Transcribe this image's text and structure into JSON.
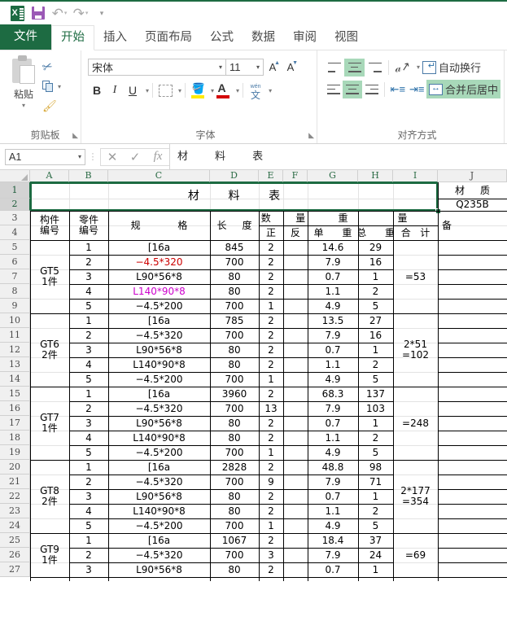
{
  "quick_access": {
    "app_icon": "excel-logo-icon",
    "items": [
      {
        "name": "save-icon",
        "label": ""
      },
      {
        "name": "undo-icon",
        "label": ""
      },
      {
        "name": "redo-icon",
        "label": ""
      },
      {
        "name": "customize-qat-icon",
        "label": ""
      }
    ]
  },
  "ribbon_tabs": [
    {
      "label": "文件",
      "active": false,
      "file": true
    },
    {
      "label": "开始",
      "active": true
    },
    {
      "label": "插入",
      "active": false
    },
    {
      "label": "页面布局",
      "active": false
    },
    {
      "label": "公式",
      "active": false
    },
    {
      "label": "数据",
      "active": false
    },
    {
      "label": "审阅",
      "active": false
    },
    {
      "label": "视图",
      "active": false
    }
  ],
  "ribbon": {
    "clipboard": {
      "group_label": "剪贴板",
      "paste_label": "粘贴",
      "cut_name": "cut-icon",
      "copy_name": "copy-icon",
      "format_painter_name": "format-painter-icon"
    },
    "font": {
      "group_label": "字体",
      "font_name": "宋体",
      "font_size": "11",
      "grow_font": "A",
      "shrink_font": "A",
      "bold": "B",
      "italic": "I",
      "underline": "U",
      "phonetic_top": "wén",
      "phonetic_bottom": "文"
    },
    "alignment": {
      "group_label": "对齐方式",
      "wrap_text": "自动换行",
      "merge_center": "合并后居中"
    }
  },
  "formula_bar": {
    "name_box": "A1",
    "cancel": "✕",
    "enter": "✓",
    "fx": "fx",
    "content": "材        料        表"
  },
  "sheet": {
    "columns": [
      "A",
      "B",
      "C",
      "D",
      "E",
      "F",
      "G",
      "H",
      "I",
      "J"
    ],
    "row_numbers": [
      1,
      2,
      3,
      4,
      5,
      6,
      7,
      8,
      9,
      10,
      11,
      12,
      13,
      14,
      15,
      16,
      17,
      18,
      19,
      20,
      21,
      22,
      23,
      24,
      25,
      26,
      27
    ],
    "selection": "A1:I2",
    "title": "材        料        表",
    "side_label_material": "材     质",
    "side_label_grade": "Q235B",
    "side_label_remark": "备",
    "headers": {
      "component_no": "构件\n编号",
      "part_no": "零件\n编号",
      "spec": "规            格",
      "length": "长     度",
      "qty_group": "数        量",
      "qty_front": "正",
      "qty_back": "反",
      "weight_group": "重                量",
      "unit_weight": "单      重",
      "total_weight": "总      重",
      "sum_weight": "合   计"
    },
    "blocks": [
      {
        "component": "GT5\n1件",
        "sum": "=53",
        "rows": [
          {
            "no": "1",
            "spec": "[16a",
            "len": "845",
            "front": "2",
            "back": "",
            "unit": "14.6",
            "total": "29",
            "color": "#000000"
          },
          {
            "no": "2",
            "spec": "−4.5*320",
            "len": "700",
            "front": "2",
            "back": "",
            "unit": "7.9",
            "total": "16",
            "color": "#cc0000"
          },
          {
            "no": "3",
            "spec": "L90*56*8",
            "len": "80",
            "front": "2",
            "back": "",
            "unit": "0.7",
            "total": "1",
            "color": "#000000"
          },
          {
            "no": "4",
            "spec": "L140*90*8",
            "len": "80",
            "front": "2",
            "back": "",
            "unit": "1.1",
            "total": "2",
            "color": "#cc00cc"
          },
          {
            "no": "5",
            "spec": "−4.5*200",
            "len": "700",
            "front": "1",
            "back": "",
            "unit": "4.9",
            "total": "5",
            "color": "#000000"
          }
        ]
      },
      {
        "component": "GT6\n2件",
        "sum": "2*51\n=102",
        "rows": [
          {
            "no": "1",
            "spec": "[16a",
            "len": "785",
            "front": "2",
            "back": "",
            "unit": "13.5",
            "total": "27",
            "color": "#000000"
          },
          {
            "no": "2",
            "spec": "−4.5*320",
            "len": "700",
            "front": "2",
            "back": "",
            "unit": "7.9",
            "total": "16",
            "color": "#000000"
          },
          {
            "no": "3",
            "spec": "L90*56*8",
            "len": "80",
            "front": "2",
            "back": "",
            "unit": "0.7",
            "total": "1",
            "color": "#000000"
          },
          {
            "no": "4",
            "spec": "L140*90*8",
            "len": "80",
            "front": "2",
            "back": "",
            "unit": "1.1",
            "total": "2",
            "color": "#000000"
          },
          {
            "no": "5",
            "spec": "−4.5*200",
            "len": "700",
            "front": "1",
            "back": "",
            "unit": "4.9",
            "total": "5",
            "color": "#000000"
          }
        ]
      },
      {
        "component": "GT7\n1件",
        "sum": "=248",
        "rows": [
          {
            "no": "1",
            "spec": "[16a",
            "len": "3960",
            "front": "2",
            "back": "",
            "unit": "68.3",
            "total": "137",
            "color": "#000000"
          },
          {
            "no": "2",
            "spec": "−4.5*320",
            "len": "700",
            "front": "13",
            "back": "",
            "unit": "7.9",
            "total": "103",
            "color": "#000000"
          },
          {
            "no": "3",
            "spec": "L90*56*8",
            "len": "80",
            "front": "2",
            "back": "",
            "unit": "0.7",
            "total": "1",
            "color": "#000000"
          },
          {
            "no": "4",
            "spec": "L140*90*8",
            "len": "80",
            "front": "2",
            "back": "",
            "unit": "1.1",
            "total": "2",
            "color": "#000000"
          },
          {
            "no": "5",
            "spec": "−4.5*200",
            "len": "700",
            "front": "1",
            "back": "",
            "unit": "4.9",
            "total": "5",
            "color": "#000000"
          }
        ]
      },
      {
        "component": "GT8\n2件",
        "sum": "2*177\n=354",
        "rows": [
          {
            "no": "1",
            "spec": "[16a",
            "len": "2828",
            "front": "2",
            "back": "",
            "unit": "48.8",
            "total": "98",
            "color": "#000000"
          },
          {
            "no": "2",
            "spec": "−4.5*320",
            "len": "700",
            "front": "9",
            "back": "",
            "unit": "7.9",
            "total": "71",
            "color": "#000000"
          },
          {
            "no": "3",
            "spec": "L90*56*8",
            "len": "80",
            "front": "2",
            "back": "",
            "unit": "0.7",
            "total": "1",
            "color": "#000000"
          },
          {
            "no": "4",
            "spec": "L140*90*8",
            "len": "80",
            "front": "2",
            "back": "",
            "unit": "1.1",
            "total": "2",
            "color": "#000000"
          },
          {
            "no": "5",
            "spec": "−4.5*200",
            "len": "700",
            "front": "1",
            "back": "",
            "unit": "4.9",
            "total": "5",
            "color": "#000000"
          }
        ]
      },
      {
        "component": "GT9\n1件",
        "sum": "=69",
        "rows": [
          {
            "no": "1",
            "spec": "[16a",
            "len": "1067",
            "front": "2",
            "back": "",
            "unit": "18.4",
            "total": "37",
            "color": "#000000"
          },
          {
            "no": "2",
            "spec": "−4.5*320",
            "len": "700",
            "front": "3",
            "back": "",
            "unit": "7.9",
            "total": "24",
            "color": "#000000"
          },
          {
            "no": "3",
            "spec": "L90*56*8",
            "len": "80",
            "front": "2",
            "back": "",
            "unit": "0.7",
            "total": "1",
            "color": "#000000"
          }
        ]
      }
    ]
  },
  "colors": {
    "excel_green": "#1d6b42",
    "ribbon_highlight": "#a8d8b9",
    "red_text": "#cc0000",
    "magenta_text": "#cc00cc"
  }
}
